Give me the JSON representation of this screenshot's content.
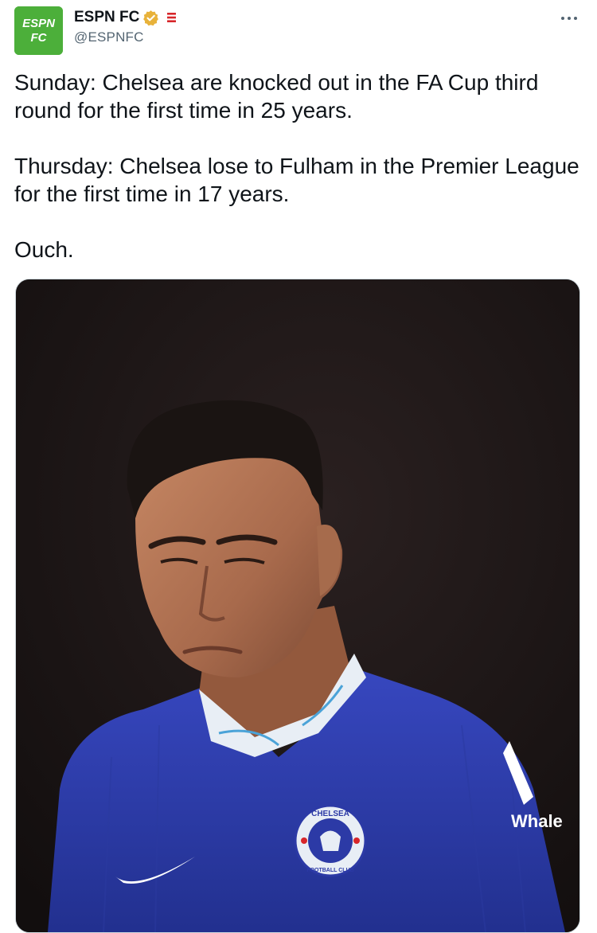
{
  "account": {
    "display_name": "ESPN FC",
    "handle": "@ESPNFC",
    "avatar_text_top": "ESPN",
    "avatar_text_bottom": "FC"
  },
  "tweet": {
    "paragraphs": [
      "Sunday: Chelsea are knocked out in the FA Cup third round for the first time in 25 years.",
      "Thursday: Chelsea lose to Fulham in the Premier League for the first time in 17 years.",
      "Ouch."
    ]
  },
  "media": {
    "sponsor_text": "Whale",
    "crest_text_top": "CHELSEA",
    "crest_text_bottom": "FOOTBALL CLUB"
  },
  "colors": {
    "avatar_bg": "#4caf3a",
    "verified_badge": "#e8b23a",
    "affiliate_red": "#d7262a",
    "jersey_blue": "#2c3aa6",
    "text_primary": "#0f1419",
    "text_secondary": "#536471"
  },
  "icons": {
    "verified": "verified-badge-icon",
    "affiliate": "espn-affiliate-icon",
    "more": "more-options-icon"
  }
}
